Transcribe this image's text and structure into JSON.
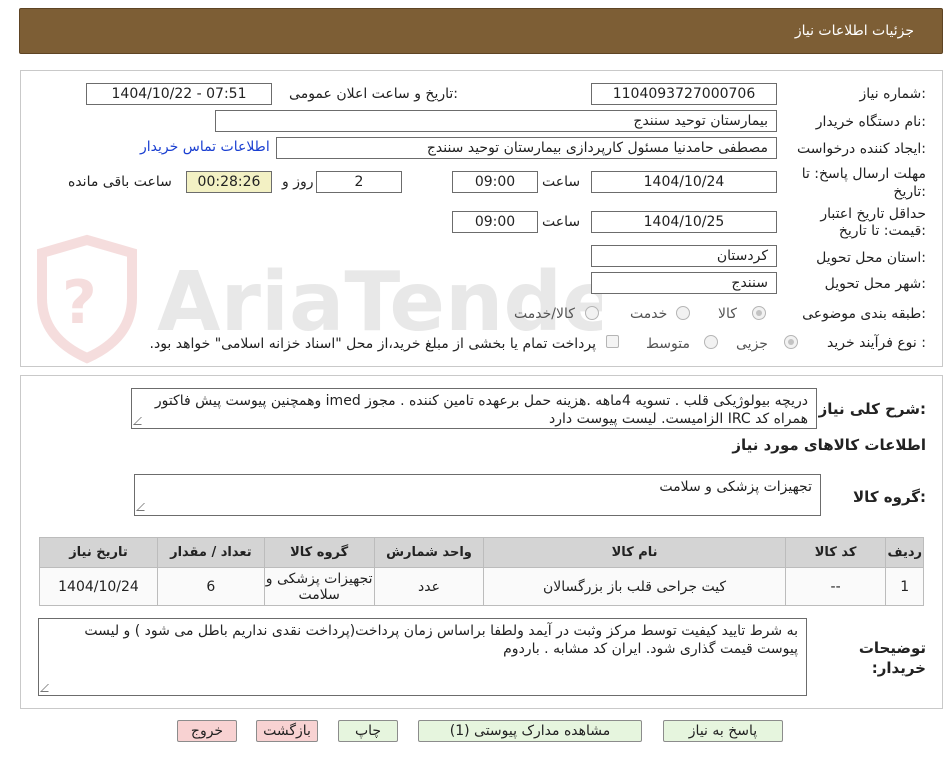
{
  "header": {
    "title": "جزئیات اطلاعات نیاز"
  },
  "form": {
    "need_number": {
      "label": "شماره نیاز:",
      "value": "1104093727000706"
    },
    "announce": {
      "label": "تاریخ و ساعت اعلان عمومی:",
      "value": "1404/10/22 - 07:51"
    },
    "buyer_org": {
      "label": "نام دستگاه خریدار:",
      "value": "بیمارستان توحید سنندج"
    },
    "requester": {
      "label": "ایجاد کننده درخواست:",
      "value": "مصطفی حامدنیا مسئول کارپردازی بیمارستان توحید سنندج",
      "contact_link": "اطلاعات تماس خریدار"
    },
    "reply_deadline": {
      "label_line1": "مهلت ارسال پاسخ: تا",
      "label_line2": "تاریخ:",
      "date": "1404/10/24",
      "time_label": "ساعت",
      "time": "09:00",
      "days": "2",
      "days_label": "روز و",
      "remaining": "00:28:26",
      "remaining_label": "ساعت باقی مانده"
    },
    "price_validity": {
      "label_line1": "حداقل تاریخ اعتبار",
      "label_line2": "قیمت: تا تاریخ:",
      "date": "1404/10/25",
      "time_label": "ساعت",
      "time": "09:00"
    },
    "province": {
      "label": "استان محل تحویل:",
      "value": "کردستان"
    },
    "city": {
      "label": "شهر محل تحویل:",
      "value": "سنندج"
    },
    "category": {
      "label": "طبقه بندی موضوعی:",
      "options": [
        "کالا",
        "خدمت",
        "کالا/خدمت"
      ],
      "selected": "کالا"
    },
    "purchase_type": {
      "label": "نوع فرآیند خرید :",
      "options": [
        "جزیی",
        "متوسط"
      ],
      "selected": "جزیی",
      "treasury_note": "پرداخت تمام یا بخشی از مبلغ خرید،از محل \"اسناد خزانه اسلامی\" خواهد بود."
    }
  },
  "summary": {
    "label": "شرح کلی نیاز:",
    "text": "دریچه بیولوژیکی قلب . تسویه 4ماهه .هزینه حمل برعهده تامین کننده . مجوز imed وهمچنین پیوست پیش فاکتور همراه کد IRC  الزامیست. لیست پیوست دارد"
  },
  "goods_section": {
    "title": "اطلاعات کالاهای مورد نیاز",
    "group_label": "گروه کالا:",
    "group_value": "تجهیزات پزشکی و سلامت"
  },
  "table": {
    "headers": [
      "ردیف",
      "کد کالا",
      "نام کالا",
      "واحد شمارش",
      "گروه کالا",
      "تعداد / مقدار",
      "تاریخ نیاز"
    ],
    "rows": [
      {
        "index": "1",
        "code": "--",
        "name": "کیت جراحی قلب باز بزرگسالان",
        "unit": "عدد",
        "group": "تجهیزات پزشکی و سلامت",
        "qty": "6",
        "date": "1404/10/24"
      }
    ]
  },
  "buyer_notes": {
    "label": "توضیحات خریدار:",
    "text": "به شرط تایید کیفیت توسط مرکز وثبت در آیمد ولطفا براساس زمان پرداخت(پرداخت نقدی نداریم باطل می شود ) و لیست پیوست قیمت گذاری شود. ایران کد مشابه . باردوم"
  },
  "buttons": {
    "reply": "پاسخ به نیاز",
    "attachments": "مشاهده مدارک پیوستی (1)",
    "print": "چاپ",
    "back": "بازگشت",
    "exit": "خروج"
  },
  "watermark": {
    "text": "AriaTender.neT"
  },
  "colors": {
    "header_bg": "#7d5e35",
    "timer_bg": "#f3f1c4",
    "green_button": "#e6f5de",
    "pink_button": "#f8d2d2",
    "link": "#1a3fd1"
  }
}
